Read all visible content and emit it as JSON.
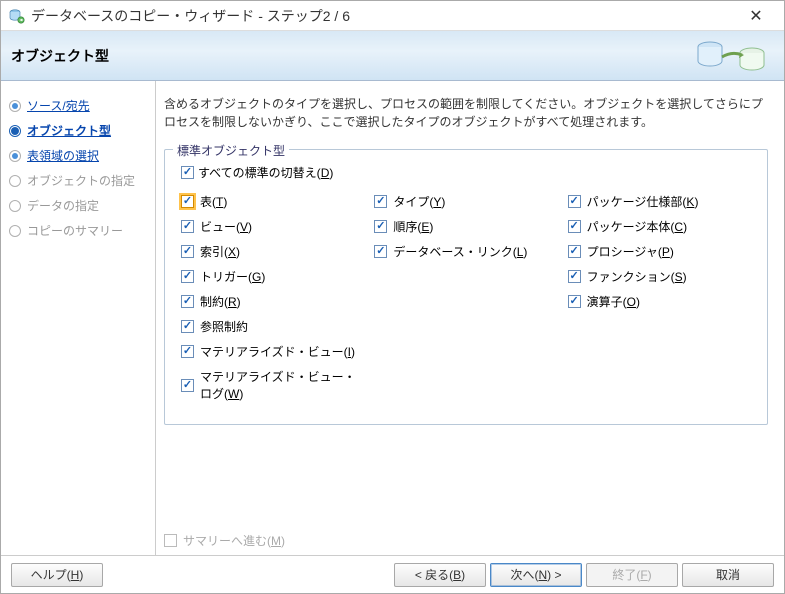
{
  "window": {
    "title": "データベースのコピー・ウィザード - ステップ2 / 6",
    "close_icon": "✕"
  },
  "header": {
    "title": "オブジェクト型"
  },
  "steps": [
    {
      "label": "ソース/宛先",
      "state": "done"
    },
    {
      "label": "オブジェクト型",
      "state": "current"
    },
    {
      "label": "表領域の選択",
      "state": "done"
    },
    {
      "label": "オブジェクトの指定",
      "state": "disabled"
    },
    {
      "label": "データの指定",
      "state": "disabled"
    },
    {
      "label": "コピーのサマリー",
      "state": "disabled"
    }
  ],
  "instructions": "含めるオブジェクトのタイプを選択し、プロセスの範囲を制限してください。オブジェクトを選択してさらにプロセスを制限しないかぎり、ここで選択したタイプのオブジェクトがすべて処理されます。",
  "fieldset": {
    "legend": "標準オブジェクト型",
    "toggle_all": {
      "checked": true,
      "label_pre": "すべての標準の切替え(",
      "key": "D",
      "label_post": ")"
    },
    "columns": [
      [
        {
          "checked": true,
          "label_pre": "表(",
          "key": "T",
          "label_post": ")",
          "highlighted": true
        },
        {
          "checked": true,
          "label_pre": "ビュー(",
          "key": "V",
          "label_post": ")"
        },
        {
          "checked": true,
          "label_pre": "索引(",
          "key": "X",
          "label_post": ")"
        },
        {
          "checked": true,
          "label_pre": "トリガー(",
          "key": "G",
          "label_post": ")"
        },
        {
          "checked": true,
          "label_pre": "制約(",
          "key": "R",
          "label_post": ")"
        },
        {
          "checked": true,
          "label_pre": "参照制約",
          "key": "",
          "label_post": ""
        },
        {
          "checked": true,
          "label_pre": "マテリアライズド・ビュー(",
          "key": "I",
          "label_post": ")"
        },
        {
          "checked": true,
          "label_pre": "マテリアライズド・ビュー・ログ(",
          "key": "W",
          "label_post": ")"
        }
      ],
      [
        {
          "checked": true,
          "label_pre": "タイプ(",
          "key": "Y",
          "label_post": ")"
        },
        {
          "checked": true,
          "label_pre": "順序(",
          "key": "E",
          "label_post": ")"
        },
        {
          "checked": true,
          "label_pre": "データベース・リンク(",
          "key": "L",
          "label_post": ")"
        }
      ],
      [
        {
          "checked": true,
          "label_pre": "パッケージ仕様部(",
          "key": "K",
          "label_post": ")"
        },
        {
          "checked": true,
          "label_pre": "パッケージ本体(",
          "key": "C",
          "label_post": ")"
        },
        {
          "checked": true,
          "label_pre": "プロシージャ(",
          "key": "P",
          "label_post": ")"
        },
        {
          "checked": true,
          "label_pre": "ファンクション(",
          "key": "S",
          "label_post": ")"
        },
        {
          "checked": true,
          "label_pre": "演算子(",
          "key": "O",
          "label_post": ")"
        }
      ]
    ]
  },
  "summary_advance": {
    "checked": false,
    "label_pre": "サマリーへ進む(",
    "key": "M",
    "label_post": ")"
  },
  "buttons": {
    "help": {
      "label_pre": "ヘルプ(",
      "key": "H",
      "label_post": ")"
    },
    "back": {
      "label_pre": "< 戻る(",
      "key": "B",
      "label_post": ")"
    },
    "next": {
      "label_pre": "次へ(",
      "key": "N",
      "label_post": ") >"
    },
    "finish": {
      "label_pre": "終了(",
      "key": "F",
      "label_post": ")"
    },
    "cancel": {
      "label": "取消"
    }
  }
}
